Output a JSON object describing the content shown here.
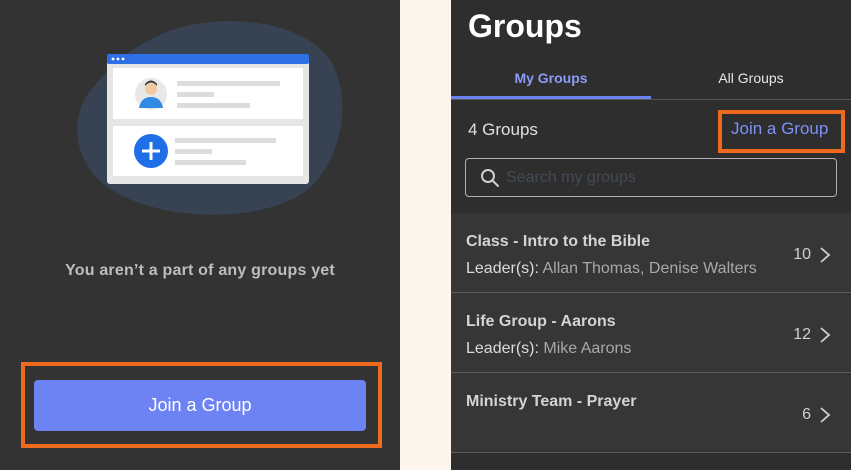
{
  "left": {
    "empty_message": "You aren’t a part of any groups yet",
    "join_button_label": "Join a Group"
  },
  "right": {
    "title": "Groups",
    "tabs": [
      {
        "label": "My Groups",
        "active": true
      },
      {
        "label": "All Groups",
        "active": false
      }
    ],
    "group_count": "4 Groups",
    "join_link_label": "Join a Group",
    "search": {
      "placeholder": "Search my groups",
      "value": ""
    },
    "leader_label": "Leader(s):",
    "groups": [
      {
        "name": "Class - Intro to the Bible",
        "leaders": "Allan Thomas, Denise Walters",
        "members": "10"
      },
      {
        "name": "Life Group - Aarons",
        "leaders": "Mike Aarons",
        "members": "12"
      },
      {
        "name": "Ministry Team - Prayer",
        "leaders": "",
        "members": "6"
      }
    ]
  },
  "colors": {
    "accent": "#6d82f3",
    "highlight": "#ee6a1f",
    "panel_bg": "#333333"
  },
  "icons": [
    "user-avatar-icon",
    "plus-icon",
    "search-icon",
    "chevron-right-icon"
  ]
}
